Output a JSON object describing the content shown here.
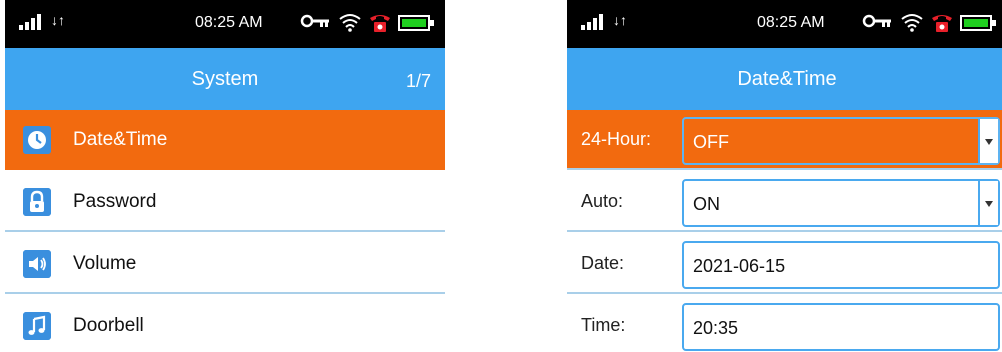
{
  "left_screen": {
    "status": {
      "time": "08:25 AM",
      "data_arrows": "↓↑"
    },
    "title": "System",
    "page": "1/7",
    "items": [
      {
        "label": "Date&Time",
        "icon": "clock-icon",
        "selected": true
      },
      {
        "label": "Password",
        "icon": "lock-icon",
        "selected": false
      },
      {
        "label": "Volume",
        "icon": "speaker-icon",
        "selected": false
      },
      {
        "label": "Doorbell",
        "icon": "music-note-icon",
        "selected": false
      }
    ]
  },
  "right_screen": {
    "status": {
      "time": "08:25 AM",
      "data_arrows": "↓↑"
    },
    "title": "Date&Time",
    "fields": [
      {
        "label": "24-Hour:",
        "value": "OFF",
        "dropdown": true,
        "selected": true
      },
      {
        "label": "Auto:",
        "value": "ON",
        "dropdown": true,
        "selected": false
      },
      {
        "label": "Date:",
        "value": "2021-06-15",
        "dropdown": false,
        "selected": false
      },
      {
        "label": "Time:",
        "value": "20:35",
        "dropdown": false,
        "selected": false
      }
    ]
  },
  "colors": {
    "status_bar": "#000000",
    "title_bar": "#3ea5f0",
    "selected_row": "#f26a0f",
    "divider": "#a9cfe9",
    "battery": "#1fcf1f",
    "phone_icon": "#e8202a"
  }
}
